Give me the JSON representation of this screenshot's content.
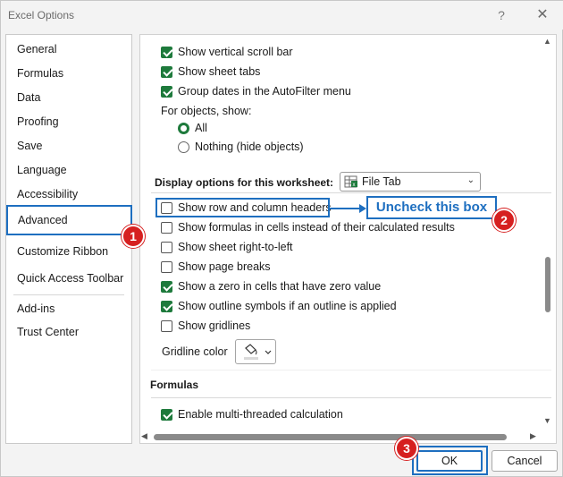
{
  "window": {
    "title": "Excel Options",
    "help_label": "?",
    "close_label": "✕"
  },
  "sidebar": {
    "items": [
      {
        "label": "General"
      },
      {
        "label": "Formulas"
      },
      {
        "label": "Data"
      },
      {
        "label": "Proofing"
      },
      {
        "label": "Save"
      },
      {
        "label": "Language"
      },
      {
        "label": "Accessibility"
      },
      {
        "label": "Advanced"
      },
      {
        "label": "Customize Ribbon"
      },
      {
        "label": "Quick Access Toolbar"
      },
      {
        "label": "Add-ins"
      },
      {
        "label": "Trust Center"
      }
    ],
    "selected": "Advanced"
  },
  "workbook_options": {
    "items": [
      {
        "label": "Show vertical scroll bar",
        "checked": true
      },
      {
        "label": "Show sheet tabs",
        "checked": true
      },
      {
        "label": "Group dates in the AutoFilter menu",
        "checked": true
      }
    ],
    "objects_label": "For objects, show:",
    "objects_options": [
      {
        "label": "All",
        "selected": true
      },
      {
        "label": "Nothing (hide objects)",
        "selected": false
      }
    ]
  },
  "worksheet_options": {
    "heading": "Display options for this worksheet:",
    "sheet_select": "File Tab",
    "items": [
      {
        "label": "Show row and column headers",
        "checked": false
      },
      {
        "label": "Show formulas in cells instead of their calculated results",
        "checked": false
      },
      {
        "label": "Show sheet right-to-left",
        "checked": false
      },
      {
        "label": "Show page breaks",
        "checked": false
      },
      {
        "label": "Show a zero in cells that have zero value",
        "checked": true
      },
      {
        "label": "Show outline symbols if an outline is applied",
        "checked": true
      },
      {
        "label": "Show gridlines",
        "checked": false
      }
    ],
    "gridline_color_label": "Gridline color"
  },
  "formulas_section": {
    "heading": "Formulas",
    "items": [
      {
        "label": "Enable multi-threaded calculation",
        "checked": true
      }
    ]
  },
  "annotations": {
    "callout": "Uncheck this box",
    "badges": [
      "1",
      "2",
      "3"
    ]
  },
  "footer": {
    "ok_label": "OK",
    "cancel_label": "Cancel"
  },
  "colors": {
    "accent_blue": "#1e6fc0",
    "check_green": "#1e7a3c",
    "badge_red": "#d62020"
  }
}
